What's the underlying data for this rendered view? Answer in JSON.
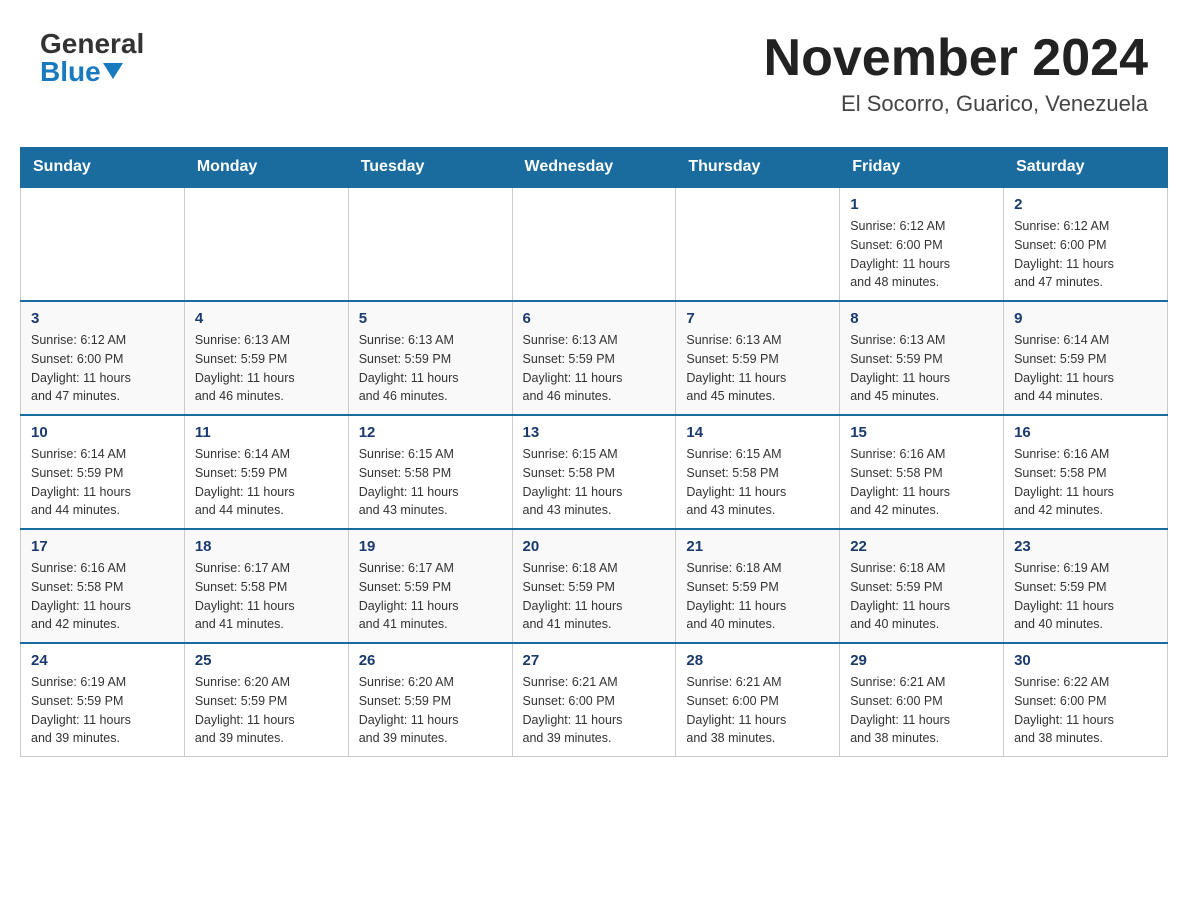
{
  "header": {
    "logo_general": "General",
    "logo_blue": "Blue",
    "month_title": "November 2024",
    "location": "El Socorro, Guarico, Venezuela"
  },
  "weekdays": [
    "Sunday",
    "Monday",
    "Tuesday",
    "Wednesday",
    "Thursday",
    "Friday",
    "Saturday"
  ],
  "weeks": [
    [
      {
        "day": "",
        "info": ""
      },
      {
        "day": "",
        "info": ""
      },
      {
        "day": "",
        "info": ""
      },
      {
        "day": "",
        "info": ""
      },
      {
        "day": "",
        "info": ""
      },
      {
        "day": "1",
        "info": "Sunrise: 6:12 AM\nSunset: 6:00 PM\nDaylight: 11 hours\nand 48 minutes."
      },
      {
        "day": "2",
        "info": "Sunrise: 6:12 AM\nSunset: 6:00 PM\nDaylight: 11 hours\nand 47 minutes."
      }
    ],
    [
      {
        "day": "3",
        "info": "Sunrise: 6:12 AM\nSunset: 6:00 PM\nDaylight: 11 hours\nand 47 minutes."
      },
      {
        "day": "4",
        "info": "Sunrise: 6:13 AM\nSunset: 5:59 PM\nDaylight: 11 hours\nand 46 minutes."
      },
      {
        "day": "5",
        "info": "Sunrise: 6:13 AM\nSunset: 5:59 PM\nDaylight: 11 hours\nand 46 minutes."
      },
      {
        "day": "6",
        "info": "Sunrise: 6:13 AM\nSunset: 5:59 PM\nDaylight: 11 hours\nand 46 minutes."
      },
      {
        "day": "7",
        "info": "Sunrise: 6:13 AM\nSunset: 5:59 PM\nDaylight: 11 hours\nand 45 minutes."
      },
      {
        "day": "8",
        "info": "Sunrise: 6:13 AM\nSunset: 5:59 PM\nDaylight: 11 hours\nand 45 minutes."
      },
      {
        "day": "9",
        "info": "Sunrise: 6:14 AM\nSunset: 5:59 PM\nDaylight: 11 hours\nand 44 minutes."
      }
    ],
    [
      {
        "day": "10",
        "info": "Sunrise: 6:14 AM\nSunset: 5:59 PM\nDaylight: 11 hours\nand 44 minutes."
      },
      {
        "day": "11",
        "info": "Sunrise: 6:14 AM\nSunset: 5:59 PM\nDaylight: 11 hours\nand 44 minutes."
      },
      {
        "day": "12",
        "info": "Sunrise: 6:15 AM\nSunset: 5:58 PM\nDaylight: 11 hours\nand 43 minutes."
      },
      {
        "day": "13",
        "info": "Sunrise: 6:15 AM\nSunset: 5:58 PM\nDaylight: 11 hours\nand 43 minutes."
      },
      {
        "day": "14",
        "info": "Sunrise: 6:15 AM\nSunset: 5:58 PM\nDaylight: 11 hours\nand 43 minutes."
      },
      {
        "day": "15",
        "info": "Sunrise: 6:16 AM\nSunset: 5:58 PM\nDaylight: 11 hours\nand 42 minutes."
      },
      {
        "day": "16",
        "info": "Sunrise: 6:16 AM\nSunset: 5:58 PM\nDaylight: 11 hours\nand 42 minutes."
      }
    ],
    [
      {
        "day": "17",
        "info": "Sunrise: 6:16 AM\nSunset: 5:58 PM\nDaylight: 11 hours\nand 42 minutes."
      },
      {
        "day": "18",
        "info": "Sunrise: 6:17 AM\nSunset: 5:58 PM\nDaylight: 11 hours\nand 41 minutes."
      },
      {
        "day": "19",
        "info": "Sunrise: 6:17 AM\nSunset: 5:59 PM\nDaylight: 11 hours\nand 41 minutes."
      },
      {
        "day": "20",
        "info": "Sunrise: 6:18 AM\nSunset: 5:59 PM\nDaylight: 11 hours\nand 41 minutes."
      },
      {
        "day": "21",
        "info": "Sunrise: 6:18 AM\nSunset: 5:59 PM\nDaylight: 11 hours\nand 40 minutes."
      },
      {
        "day": "22",
        "info": "Sunrise: 6:18 AM\nSunset: 5:59 PM\nDaylight: 11 hours\nand 40 minutes."
      },
      {
        "day": "23",
        "info": "Sunrise: 6:19 AM\nSunset: 5:59 PM\nDaylight: 11 hours\nand 40 minutes."
      }
    ],
    [
      {
        "day": "24",
        "info": "Sunrise: 6:19 AM\nSunset: 5:59 PM\nDaylight: 11 hours\nand 39 minutes."
      },
      {
        "day": "25",
        "info": "Sunrise: 6:20 AM\nSunset: 5:59 PM\nDaylight: 11 hours\nand 39 minutes."
      },
      {
        "day": "26",
        "info": "Sunrise: 6:20 AM\nSunset: 5:59 PM\nDaylight: 11 hours\nand 39 minutes."
      },
      {
        "day": "27",
        "info": "Sunrise: 6:21 AM\nSunset: 6:00 PM\nDaylight: 11 hours\nand 39 minutes."
      },
      {
        "day": "28",
        "info": "Sunrise: 6:21 AM\nSunset: 6:00 PM\nDaylight: 11 hours\nand 38 minutes."
      },
      {
        "day": "29",
        "info": "Sunrise: 6:21 AM\nSunset: 6:00 PM\nDaylight: 11 hours\nand 38 minutes."
      },
      {
        "day": "30",
        "info": "Sunrise: 6:22 AM\nSunset: 6:00 PM\nDaylight: 11 hours\nand 38 minutes."
      }
    ]
  ]
}
